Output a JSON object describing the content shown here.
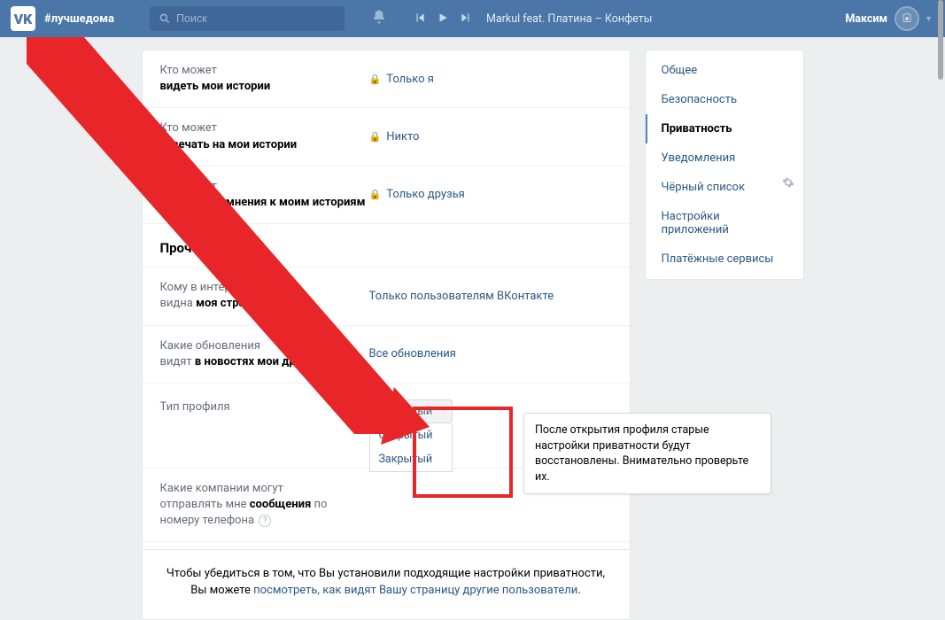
{
  "header": {
    "hashtag": "#лучшедома",
    "search_placeholder": "Поиск",
    "track": "Markul feat. Платина – Конфеты",
    "username": "Максим"
  },
  "rows": {
    "stories_view": {
      "q": "Кто может",
      "b": "видеть мои истории",
      "val": "Только я"
    },
    "stories_reply": {
      "q": "Кто может",
      "b": "отвечать на мои истории",
      "val": "Никто"
    },
    "stories_feedback": {
      "q": "Кто может",
      "b": "отправлять мнения к моим историям",
      "val": "Только друзья"
    }
  },
  "section_other": "Прочее",
  "other": {
    "page_visibility": {
      "q1": "Кому в интернете",
      "q2": "видна ",
      "b": "моя страница",
      "val": "Только пользователям ВКонтакте"
    },
    "feed_updates": {
      "q1": "Какие обновления",
      "q2": "видят ",
      "b": "в новостях мои друзья",
      "val": "Все обновления"
    },
    "profile_type": {
      "label": "Тип профиля",
      "selected": "Закрытый",
      "opt1": "Открытый",
      "opt2": "Закрытый"
    },
    "company_msgs": {
      "q1": "Какие компании могут",
      "q2": "отправлять мне ",
      "b": "сообщения",
      "q3": " по номеру телефона"
    }
  },
  "tooltip": "После открытия профиля старые настройки приватности будут восстановлены. Внимательно проверьте их.",
  "footer": {
    "line1": "Чтобы убедиться в том, что Вы установили подходящие настройки приватности,",
    "line2_a": "Вы можете ",
    "line2_link": "посмотреть, как видят Вашу страницу другие пользователи",
    "line2_b": "."
  },
  "sidebar": {
    "items": [
      "Общее",
      "Безопасность",
      "Приватность",
      "Уведомления",
      "Чёрный список",
      "Настройки приложений",
      "Платёжные сервисы"
    ],
    "active_index": 2
  }
}
